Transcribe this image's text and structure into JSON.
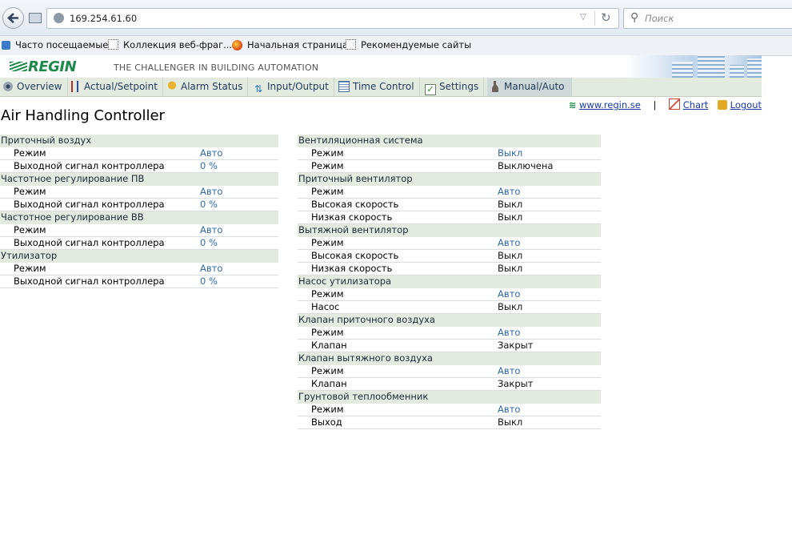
{
  "browser": {
    "url": "169.254.61.60",
    "search_placeholder": "Поиск",
    "bookmarks": [
      "Часто посещаемые",
      "Коллекция веб-фраг...",
      "Начальная страница",
      "Рекомендуемые сайты"
    ]
  },
  "header": {
    "logo": "REGIN",
    "tagline": "THE CHALLENGER IN BUILDING AUTOMATION"
  },
  "nav": {
    "tabs": [
      "Overview",
      "Actual/Setpoint",
      "Alarm Status",
      "Input/Output",
      "Time Control",
      "Settings",
      "Manual/Auto"
    ],
    "active": "Manual/Auto"
  },
  "links": {
    "site": "www.regin.se",
    "sep": "|",
    "chart": "Chart",
    "logout": "Logout"
  },
  "page_title": "Air Handling Controller",
  "colors": {
    "group_bg": "#e3ebe1",
    "link_value": "#2f6aa6",
    "logo": "#1d8a4c"
  },
  "left_groups": [
    {
      "title": "Приточный воздух",
      "rows": [
        {
          "label": "Режим",
          "value": "Авто"
        },
        {
          "label": "Выходной сигнал контроллера",
          "value": "0 %"
        }
      ]
    },
    {
      "title": "Частотное регулирование ПВ",
      "rows": [
        {
          "label": "Режим",
          "value": "Авто"
        },
        {
          "label": "Выходной сигнал контроллера",
          "value": "0 %"
        }
      ]
    },
    {
      "title": "Частотное регулирование ВВ",
      "rows": [
        {
          "label": "Режим",
          "value": "Авто"
        },
        {
          "label": "Выходной сигнал контроллера",
          "value": "0 %"
        }
      ]
    },
    {
      "title": "Утилизатор",
      "rows": [
        {
          "label": "Режим",
          "value": "Авто"
        },
        {
          "label": "Выходной сигнал контроллера",
          "value": "0 %"
        }
      ]
    }
  ],
  "right_groups": [
    {
      "title": "Вентиляционная система",
      "rows": [
        {
          "label": "Режим",
          "value": "Выкл"
        },
        {
          "label": "Режим",
          "value": "Выключена"
        }
      ]
    },
    {
      "title": "Приточный вентилятор",
      "rows": [
        {
          "label": "Режим",
          "value": "Авто"
        },
        {
          "label": "Высокая скорость",
          "value": "Выкл"
        },
        {
          "label": "Низкая скорость",
          "value": "Выкл"
        }
      ]
    },
    {
      "title": "Вытяжной вентилятор",
      "rows": [
        {
          "label": "Режим",
          "value": "Авто"
        },
        {
          "label": "Высокая скорость",
          "value": "Выкл"
        },
        {
          "label": "Низкая скорость",
          "value": "Выкл"
        }
      ]
    },
    {
      "title": "Насос утилизатора",
      "rows": [
        {
          "label": "Режим",
          "value": "Авто"
        },
        {
          "label": "Насос",
          "value": "Выкл"
        }
      ]
    },
    {
      "title": "Клапан приточного воздуха",
      "rows": [
        {
          "label": "Режим",
          "value": "Авто"
        },
        {
          "label": "Клапан",
          "value": "Закрыт"
        }
      ]
    },
    {
      "title": "Клапан вытяжного воздуха",
      "rows": [
        {
          "label": "Режим",
          "value": "Авто"
        },
        {
          "label": "Клапан",
          "value": "Закрыт"
        }
      ]
    },
    {
      "title": "Грунтовой теплообменник",
      "rows": [
        {
          "label": "Режим",
          "value": "Авто"
        },
        {
          "label": "Выход",
          "value": "Выкл"
        }
      ]
    }
  ]
}
